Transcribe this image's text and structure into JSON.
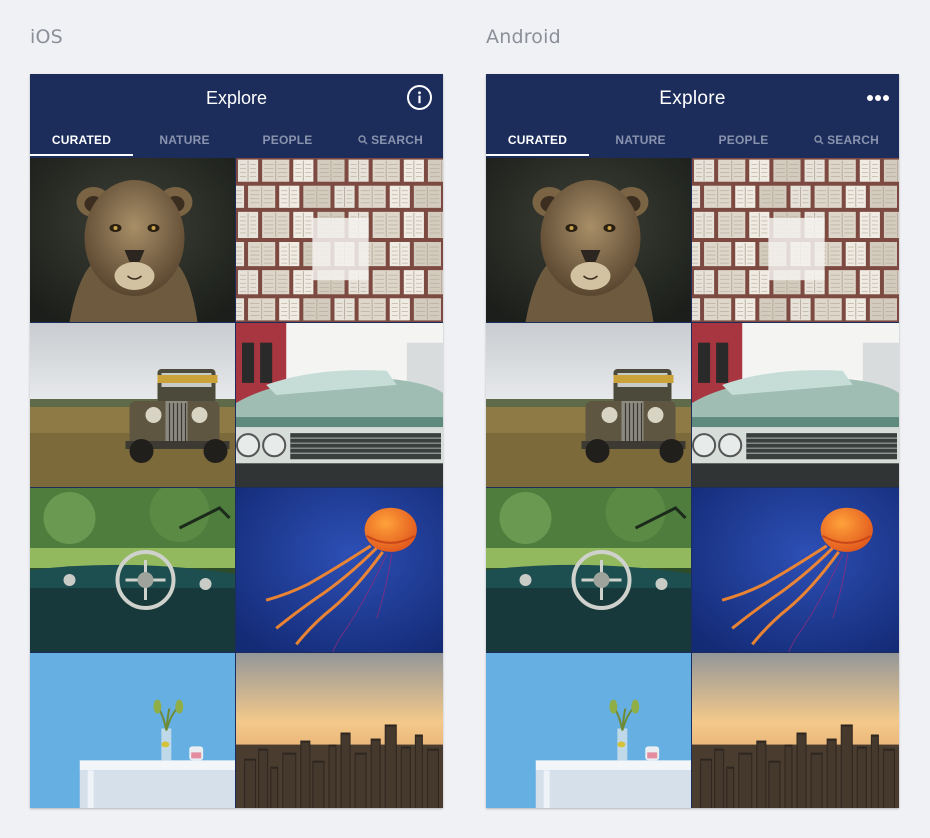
{
  "platforms": [
    {
      "id": "ios",
      "label": "iOS",
      "screen_title": "Explore",
      "action_icon": "info-icon",
      "tabs": [
        "CURATED",
        "NATURE",
        "PEOPLE",
        "SEARCH"
      ],
      "active_tab": "CURATED"
    },
    {
      "id": "android",
      "label": "Android",
      "screen_title": "Explore",
      "action_icon": "more-icon",
      "tabs": [
        "CURATED",
        "NATURE",
        "PEOPLE",
        "SEARCH"
      ],
      "active_tab": "CURATED"
    }
  ],
  "photos": [
    {
      "subject": "lioness",
      "icon": "lioness-photo"
    },
    {
      "subject": "book pages",
      "icon": "book-pages-photo"
    },
    {
      "subject": "vintage truck",
      "icon": "vintage-truck-photo"
    },
    {
      "subject": "classic car",
      "icon": "classic-car-photo"
    },
    {
      "subject": "car dashboard",
      "icon": "car-dashboard-photo"
    },
    {
      "subject": "jellyfish",
      "icon": "jellyfish-photo"
    },
    {
      "subject": "plant on table",
      "icon": "plant-table-photo"
    },
    {
      "subject": "city skyline",
      "icon": "city-skyline-photo"
    }
  ],
  "colors": {
    "app_bar": "#1c2d5c",
    "page_background": "#f0f1f5",
    "tab_inactive": "#8a93ad",
    "tab_active": "#ffffff"
  }
}
